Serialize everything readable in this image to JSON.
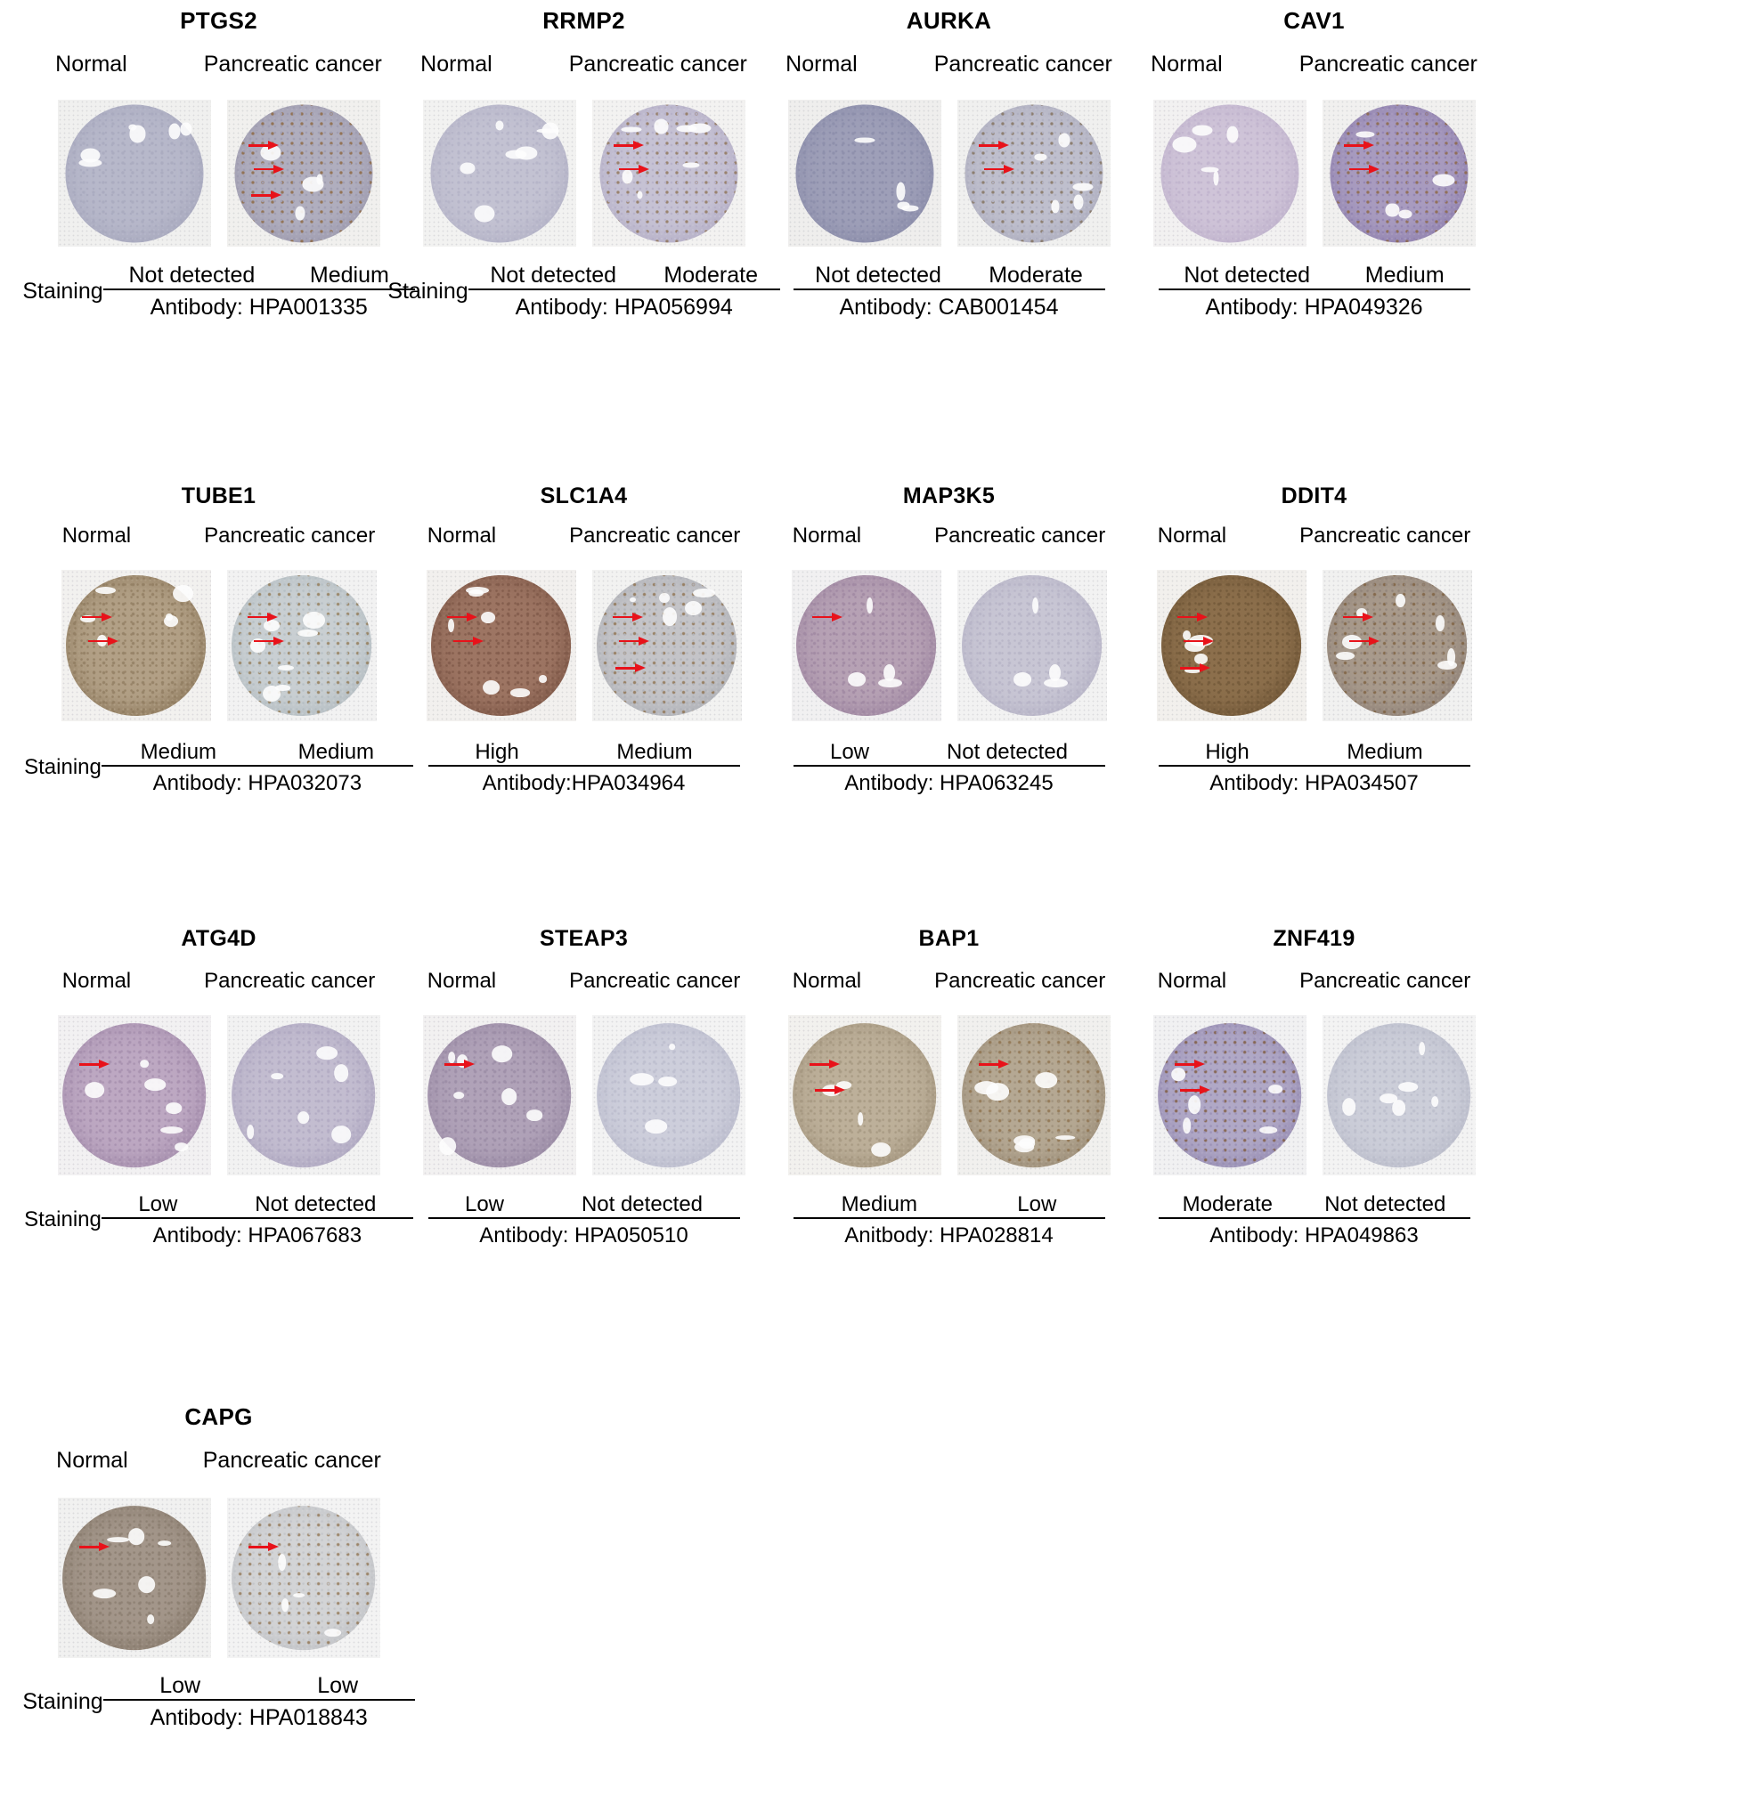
{
  "figure": {
    "staining_label": "Staining",
    "condition_normal": "Normal",
    "condition_cancer": "Pancreatic cancer"
  },
  "panels": [
    {
      "gene": "PTGS2",
      "normal_label": "Normal",
      "cancer_label": "Pancreatic cancer",
      "staining_label": "Staining",
      "staining_normal": "Not detected",
      "staining_cancer": "Medium",
      "antibody": "Antibody: HPA001335",
      "normal_core": {
        "tone": "#b7b8ca",
        "rim": "#a7a8bd",
        "bg": "#f0f0ef"
      },
      "cancer_core": {
        "tone": "#b0aebe",
        "rim": "#9d9aae",
        "bg": "#f1f0ee",
        "brown": "#8a6134"
      },
      "arrows_normal": 0,
      "arrows_cancer": 3
    },
    {
      "gene": "RRMP2",
      "normal_label": "Normal",
      "cancer_label": "Pancreatic cancer",
      "staining_label": "Staining",
      "staining_normal": "Not detected",
      "staining_cancer": "Moderate",
      "antibody": "Antibody: HPA056994",
      "normal_core": {
        "tone": "#c3c2d2",
        "rim": "#b3b2c6",
        "bg": "#f2f2f1"
      },
      "cancer_core": {
        "tone": "#c6c2d4",
        "rim": "#b4aec6",
        "bg": "#f3f2f1",
        "brown": "#8b6e4d"
      },
      "arrows_normal": 0,
      "arrows_cancer": 2
    },
    {
      "gene": "AURKA",
      "normal_label": "Normal",
      "cancer_label": "Pancreatic cancer",
      "staining_label": "",
      "staining_normal": "Not detected",
      "staining_cancer": "Moderate",
      "antibody": "Antibody: CAB001454",
      "normal_core": {
        "tone": "#9e9fb8",
        "rim": "#8a8ca9",
        "bg": "#efeeed"
      },
      "cancer_core": {
        "tone": "#bfbfcd",
        "rim": "#adadbe",
        "bg": "#f0f0ef",
        "brown": "#7d6a52"
      },
      "arrows_normal": 0,
      "arrows_cancer": 2
    },
    {
      "gene": "CAV1",
      "normal_label": "Normal",
      "cancer_label": "Pancreatic cancer",
      "staining_label": "",
      "staining_normal": "Not detected",
      "staining_cancer": "Medium",
      "antibody": "Antibody: HPA049326",
      "normal_core": {
        "tone": "#cfc4d8",
        "rim": "#bfb2cc",
        "bg": "#f2f1f1"
      },
      "cancer_core": {
        "tone": "#a89bbf",
        "rim": "#8f80ae",
        "bg": "#f1f0ef",
        "brown": "#8a6238"
      },
      "arrows_normal": 0,
      "arrows_cancer": 2
    },
    {
      "gene": "TUBE1",
      "normal_label": "Normal",
      "cancer_label": "Pancreatic cancer",
      "staining_label": "Staining",
      "staining_normal": "Medium",
      "staining_cancer": "Medium",
      "antibody": "Antibody: HPA032073",
      "normal_core": {
        "tone": "#b2a086",
        "rim": "#8e7a5e",
        "bg": "#f2f1ef"
      },
      "cancer_core": {
        "tone": "#c9cfd2",
        "rim": "#b3bcc1",
        "bg": "#f2f2f2",
        "brown": "#8d7249"
      },
      "arrows_normal": 2,
      "arrows_cancer": 2
    },
    {
      "gene": "SLC1A4",
      "normal_label": "Normal",
      "cancer_label": "Pancreatic cancer",
      "staining_label": "",
      "staining_normal": "High",
      "staining_cancer": "Medium",
      "antibody": "Antibody:HPA034964",
      "normal_core": {
        "tone": "#9d7563",
        "rim": "#7d5747",
        "bg": "#f2f0ee"
      },
      "cancer_core": {
        "tone": "#c4c4c8",
        "rim": "#aeb0b6",
        "bg": "#f2f2f1",
        "brown": "#8a6b45"
      },
      "arrows_normal": 2,
      "arrows_cancer": 3
    },
    {
      "gene": "MAP3K5",
      "normal_label": "Normal",
      "cancer_label": "Pancreatic cancer",
      "staining_label": "",
      "staining_normal": "Low",
      "staining_cancer": "Not detected",
      "antibody": "Antibody:  HPA063245",
      "normal_core": {
        "tone": "#b6a1b4",
        "rim": "#9d85a0",
        "bg": "#f1f0f1"
      },
      "cancer_core": {
        "tone": "#c8c6d4",
        "rim": "#b5b2c5",
        "bg": "#f2f2f2"
      },
      "arrows_normal": 1,
      "arrows_cancer": 0
    },
    {
      "gene": "DDIT4",
      "normal_label": "Normal",
      "cancer_label": "Pancreatic cancer",
      "staining_label": "",
      "staining_normal": "High",
      "staining_cancer": "Medium",
      "antibody": "Antibody:  HPA034507",
      "normal_core": {
        "tone": "#8c6f4c",
        "rim": "#6f5637",
        "bg": "#f2f0ed"
      },
      "cancer_core": {
        "tone": "#a89a8c",
        "rim": "#8e8076",
        "bg": "#f1f1f0",
        "brown": "#7a5b38"
      },
      "arrows_normal": 3,
      "arrows_cancer": 2
    },
    {
      "gene": "ATG4D",
      "normal_label": "Normal",
      "cancer_label": "Pancreatic cancer",
      "staining_label": "Staining",
      "staining_normal": "Low",
      "staining_cancer": "Not detected",
      "antibody": "Antibody: HPA067683",
      "normal_core": {
        "tone": "#bda8c2",
        "rim": "#a38cab",
        "bg": "#f2f1f2"
      },
      "cancer_core": {
        "tone": "#c3bdd0",
        "rim": "#aea7c0",
        "bg": "#f2f2f2"
      },
      "arrows_normal": 1,
      "arrows_cancer": 0
    },
    {
      "gene": "STEAP3",
      "normal_label": "Normal",
      "cancer_label": "Pancreatic cancer",
      "staining_label": "",
      "staining_normal": "Low",
      "staining_cancer": "Not detected",
      "antibody": "Antibody:  HPA050510",
      "normal_core": {
        "tone": "#b0a2b8",
        "rim": "#9889a3",
        "bg": "#f2f1f1"
      },
      "cancer_core": {
        "tone": "#cdcedb",
        "rim": "#b9bacb",
        "bg": "#f3f3f3"
      },
      "arrows_normal": 1,
      "arrows_cancer": 0
    },
    {
      "gene": "BAP1",
      "normal_label": "Normal",
      "cancer_label": "Pancreatic cancer",
      "staining_label": "",
      "staining_normal": "Medium",
      "staining_cancer": "Low",
      "antibody": "Anitbody: HPA028814",
      "normal_core": {
        "tone": "#bdb09a",
        "rim": "#a2947d",
        "bg": "#f2f1ee"
      },
      "cancer_core": {
        "tone": "#b5a893",
        "rim": "#9b8d78",
        "bg": "#f1f0ee",
        "brown": "#8a6c46"
      },
      "arrows_normal": 2,
      "arrows_cancer": 1
    },
    {
      "gene": "ZNF419",
      "normal_label": "Normal",
      "cancer_label": "Pancreatic cancer",
      "staining_label": "",
      "staining_normal": "Moderate",
      "staining_cancer": "Not detected",
      "antibody": "Antibody:  HPA049863",
      "normal_core": {
        "tone": "#b0a8c6",
        "rim": "#968cb2",
        "bg": "#f1f1f2",
        "brown": "#7a5330"
      },
      "cancer_core": {
        "tone": "#ccced9",
        "rim": "#b9bbc9",
        "bg": "#f3f3f3"
      },
      "arrows_normal": 2,
      "arrows_cancer": 0
    },
    {
      "gene": "CAPG",
      "normal_label": "Normal",
      "cancer_label": "Pancreatic cancer",
      "staining_label": "Staining",
      "staining_normal": "Low",
      "staining_cancer": "Low",
      "antibody": "Antibody: HPA018843",
      "normal_core": {
        "tone": "#a3968a",
        "rim": "#887b6d",
        "bg": "#f1f1f0"
      },
      "cancer_core": {
        "tone": "#d3d4d6",
        "rim": "#c0c2c6",
        "bg": "#f3f3f3",
        "brown": "#8b6c46"
      },
      "arrows_normal": 1,
      "arrows_cancer": 1
    }
  ]
}
